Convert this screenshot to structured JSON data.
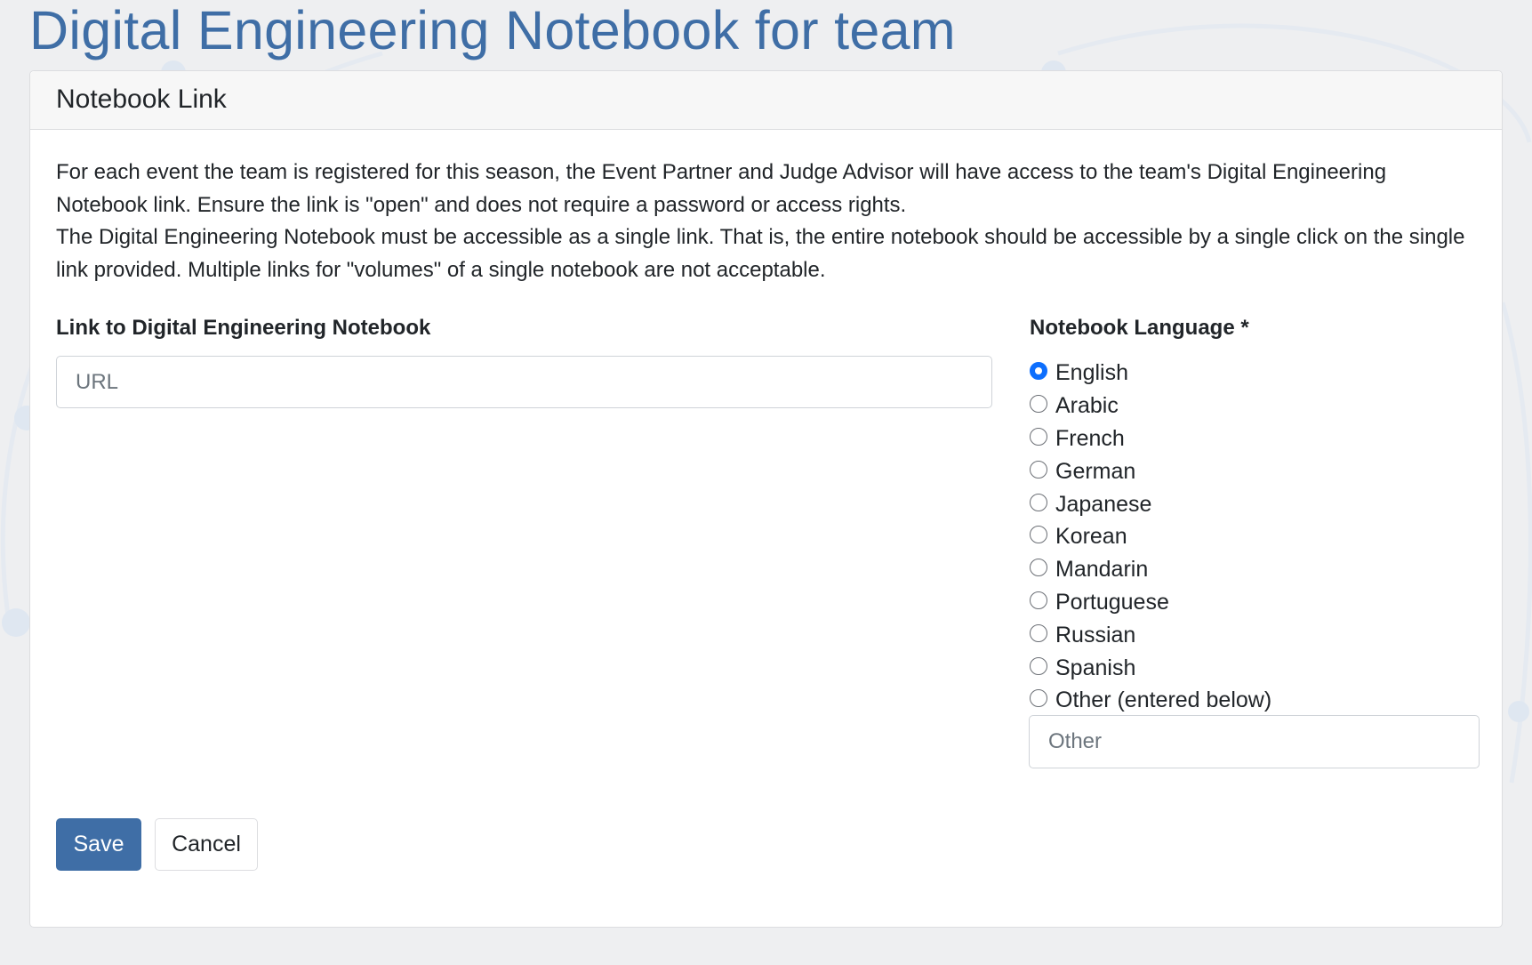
{
  "page": {
    "title": "Digital Engineering Notebook for team"
  },
  "card": {
    "title": "Notebook Link",
    "intro_line1": "For each event the team is registered for this season, the Event Partner and Judge Advisor will have access to the team's Digital Engineering Notebook link. Ensure the link is \"open\" and does not require a password or access rights.",
    "intro_line2": "The Digital Engineering Notebook must be accessible as a single link. That is, the entire notebook should be accessible by a single click on the single link provided. Multiple links for \"volumes\" of a single notebook are not acceptable."
  },
  "link_field": {
    "label": "Link to Digital Engineering Notebook",
    "placeholder": "URL",
    "value": ""
  },
  "language_field": {
    "label": "Notebook Language *",
    "selected": "English",
    "options": [
      "English",
      "Arabic",
      "French",
      "German",
      "Japanese",
      "Korean",
      "Mandarin",
      "Portuguese",
      "Russian",
      "Spanish",
      "Other (entered below)"
    ],
    "other_placeholder": "Other",
    "other_value": ""
  },
  "actions": {
    "save_label": "Save",
    "cancel_label": "Cancel"
  },
  "colors": {
    "accent": "#3f6ea6",
    "radio_checked": "#0d6efd",
    "background": "#eeeff1"
  }
}
